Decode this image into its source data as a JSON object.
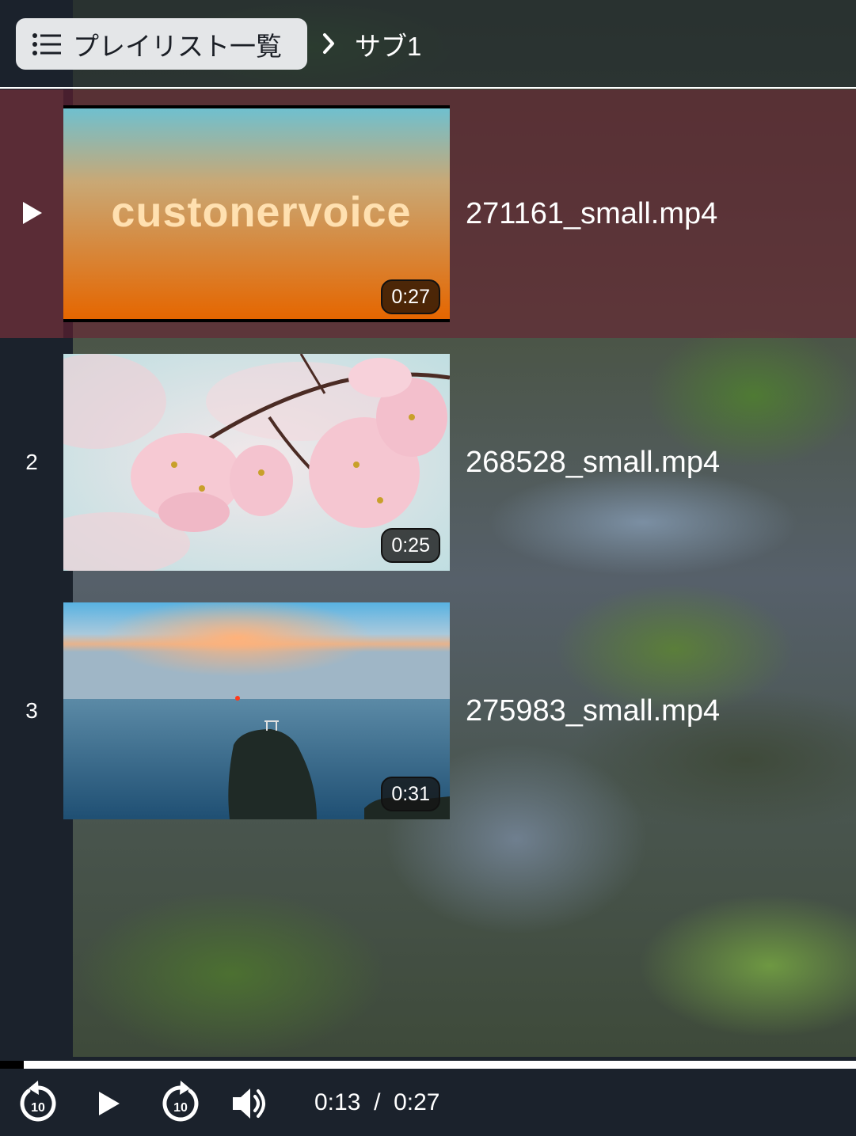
{
  "header": {
    "playlist_button_label": "プレイリスト一覧",
    "breadcrumb_current": "サブ1"
  },
  "playlist": {
    "items": [
      {
        "index": "",
        "state": "playing",
        "title": "271161_small.mp4",
        "duration": "0:27",
        "thumbnail_text": "custonervoice"
      },
      {
        "index": "2",
        "state": "idle",
        "title": "268528_small.mp4",
        "duration": "0:25"
      },
      {
        "index": "3",
        "state": "idle",
        "title": "275983_small.mp4",
        "duration": "0:31"
      }
    ]
  },
  "player": {
    "current_time": "0:13",
    "separator": "/",
    "total_time": "0:27",
    "progress_fraction": 0.028,
    "rewind_seconds": "10",
    "forward_seconds": "10"
  },
  "colors": {
    "active_row": "#6e1e32",
    "panel": "#1b222c",
    "button_bg": "#e4e6e8"
  },
  "icons": [
    "list-icon",
    "chevron-right-icon",
    "play-icon",
    "rewind-10-icon",
    "forward-10-icon",
    "volume-icon"
  ]
}
